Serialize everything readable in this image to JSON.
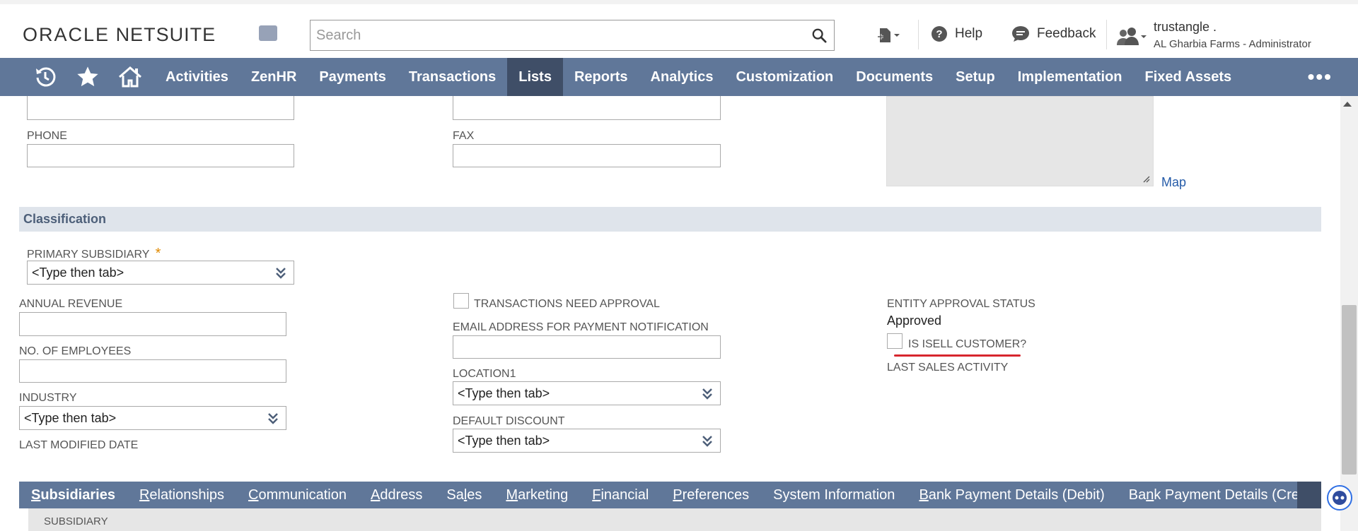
{
  "header": {
    "logo_oracle": "ORACLE",
    "logo_netsuite": "NETSUITE",
    "search_placeholder": "Search",
    "help_label": "Help",
    "feedback_label": "Feedback",
    "user_name": "trustangle .",
    "user_role": "AL Gharbia Farms - Administrator"
  },
  "nav": {
    "items": [
      "Activities",
      "ZenHR",
      "Payments",
      "Transactions",
      "Lists",
      "Reports",
      "Analytics",
      "Customization",
      "Documents",
      "Setup",
      "Implementation",
      "Fixed Assets"
    ],
    "active": "Lists",
    "more": "•••"
  },
  "address_section": {
    "phone_label": "PHONE",
    "fax_label": "FAX",
    "map_link": "Map"
  },
  "classification": {
    "title": "Classification",
    "primary_subsidiary_label": "PRIMARY SUBSIDIARY",
    "required_mark": "*",
    "primary_subsidiary_value": "<Type then tab>",
    "annual_revenue_label": "ANNUAL REVENUE",
    "employees_label": "NO. OF EMPLOYEES",
    "industry_label": "INDUSTRY",
    "industry_value": "<Type then tab>",
    "last_modified_label": "LAST MODIFIED DATE",
    "transactions_approval_label": "TRANSACTIONS NEED APPROVAL",
    "email_payment_label": "EMAIL ADDRESS FOR PAYMENT NOTIFICATION",
    "location_label": "LOCATION1",
    "location_value": "<Type then tab>",
    "discount_label": "DEFAULT DISCOUNT",
    "discount_value": "<Type then tab>",
    "approval_status_label": "ENTITY APPROVAL STATUS",
    "approval_status_value": "Approved",
    "isell_label": "IS ISELL CUSTOMER?",
    "last_sales_label": "LAST SALES ACTIVITY"
  },
  "subtabs": {
    "items": [
      {
        "pre": "",
        "key": "S",
        "post": "ubsidiaries"
      },
      {
        "pre": "",
        "key": "R",
        "post": "elationships"
      },
      {
        "pre": "",
        "key": "C",
        "post": "ommunication"
      },
      {
        "pre": "",
        "key": "A",
        "post": "ddress"
      },
      {
        "pre": "Sa",
        "key": "l",
        "post": "es"
      },
      {
        "pre": "",
        "key": "M",
        "post": "arketing"
      },
      {
        "pre": "",
        "key": "F",
        "post": "inancial"
      },
      {
        "pre": "",
        "key": "P",
        "post": "references"
      },
      {
        "pre": "System Information",
        "key": "",
        "post": ""
      },
      {
        "pre": "",
        "key": "B",
        "post": "ank Payment Details (Debit)"
      },
      {
        "pre": "Ba",
        "key": "n",
        "post": "k Payment Details (Credit)"
      }
    ],
    "panel_label": "SUBSIDIARY"
  }
}
